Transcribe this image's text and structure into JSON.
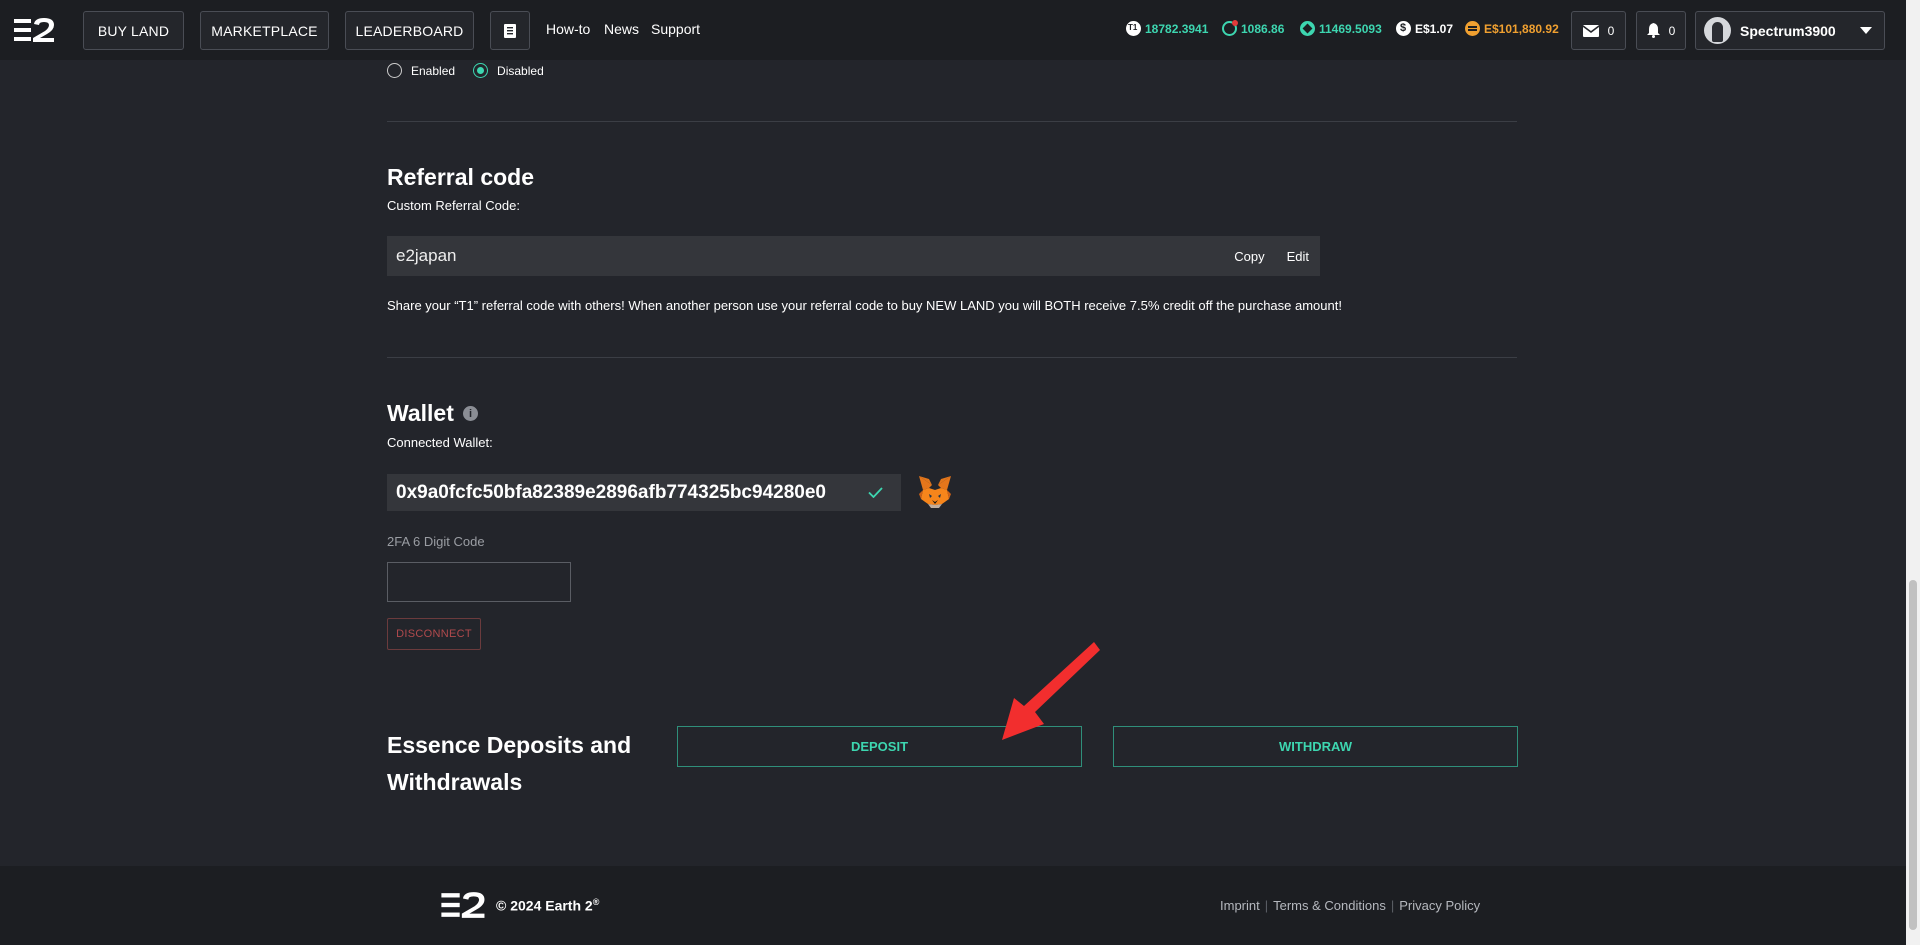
{
  "nav": {
    "buy_land": "BUY LAND",
    "marketplace": "MARKETPLACE",
    "leaderboard": "LEADERBOARD",
    "howto": "How-to",
    "news": "News",
    "support": "Support"
  },
  "stats": {
    "t1": "18782.3941",
    "target": "1086.86",
    "essence": "11469.5093",
    "esprice": "E$1.07",
    "balance": "E$101,880.92",
    "colors": {
      "green": "#3dd6b0",
      "orange": "#f0a030",
      "white": "#ffffff"
    }
  },
  "mail_count": "0",
  "notif_count": "0",
  "user": {
    "name": "Spectrum3900"
  },
  "radio": {
    "enabled": "Enabled",
    "disabled": "Disabled",
    "selected": "Disabled"
  },
  "referral": {
    "title": "Referral code",
    "label": "Custom Referral Code:",
    "code": "e2japan",
    "copy": "Copy",
    "edit": "Edit",
    "note": "Share your “T1” referral code with others! When another person use your referral code to buy NEW LAND you will BOTH receive 7.5% credit off the purchase amount!"
  },
  "wallet": {
    "title": "Wallet",
    "label": "Connected Wallet:",
    "address": "0x9a0fcfc50bfa82389e2896afb774325bc94280e0",
    "twofa_label": "2FA 6 Digit Code",
    "disconnect": "DISCONNECT"
  },
  "essence": {
    "title": "Essence Deposits and Withdrawals",
    "deposit": "DEPOSIT",
    "withdraw": "WITHDRAW"
  },
  "footer": {
    "copyright": "© 2024 Earth 2",
    "reg": "®",
    "imprint": "Imprint",
    "terms": "Terms & Conditions",
    "privacy": "Privacy Policy"
  }
}
